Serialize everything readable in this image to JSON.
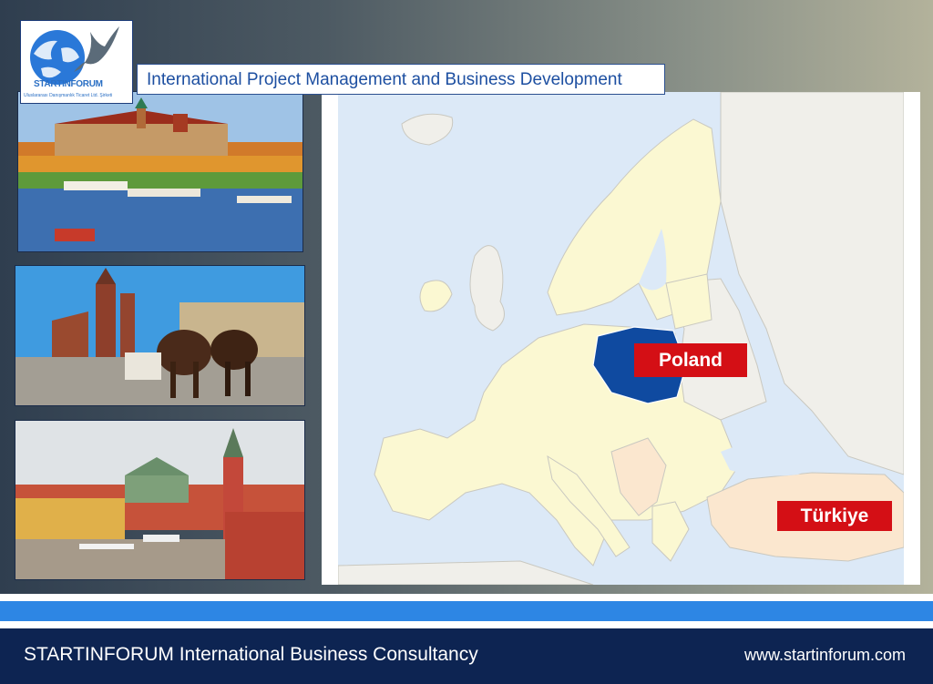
{
  "logo": {
    "name": "STARTINFORUM",
    "subtitle": "Uluslararası Danışmanlık Ticaret Ltd. Şirketi"
  },
  "header": {
    "title": "International Project Management and Business Development"
  },
  "photos": [
    {
      "subject": "Wawel Castle, Kraków, on the Vistula river"
    },
    {
      "subject": "Kraków Main Market Square with horse carriages"
    },
    {
      "subject": "Warsaw Castle Square and Old Town"
    }
  ],
  "map": {
    "region": "Europe",
    "labels": {
      "poland": "Poland",
      "turkiye": "Türkiye"
    },
    "colors": {
      "sea": "#dce9f7",
      "eu_land": "#fbf8d2",
      "other_land": "#f0efea",
      "balkans_and_turkey": "#fbe7cf",
      "poland": "#0f4aa0",
      "label_bg": "#d40f15"
    }
  },
  "footer": {
    "company": "STARTINFORUM International Business Consultancy",
    "website": "www.startinforum.com"
  },
  "colors": {
    "footer_bg": "#0d2452",
    "stripe_blue": "#2d86e4",
    "title_text": "#1d4fa1"
  }
}
